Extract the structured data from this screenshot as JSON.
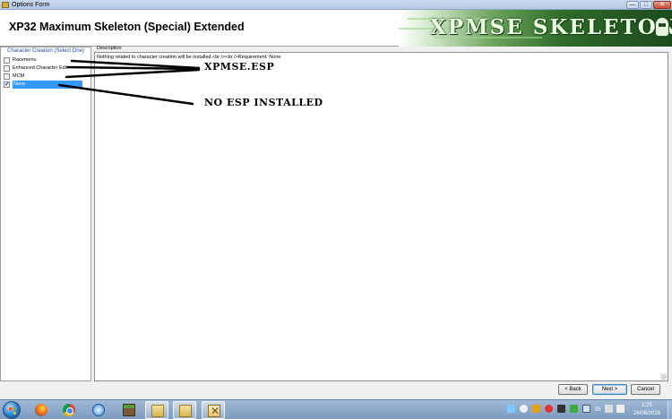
{
  "window": {
    "title": "Options Form",
    "buttons": {
      "minimize": "—",
      "maximize": "□",
      "close": "✕"
    }
  },
  "header": {
    "heading": "XP32 Maximum Skeleton (Special) Extended",
    "banner_text": "XPMSE SKELETON"
  },
  "left_panel": {
    "group_title": "Character Creation (Select One)",
    "options": [
      {
        "label": "Racemenu",
        "checked": false,
        "selected": false
      },
      {
        "label": "Enhanced Character Edit",
        "checked": false,
        "selected": false
      },
      {
        "label": "MCM",
        "checked": false,
        "selected": false
      },
      {
        "label": "None",
        "checked": true,
        "selected": true
      }
    ]
  },
  "description": {
    "label": "Description",
    "text": "Nothing related to character creation will be installed.<br /><br />Requirement: None"
  },
  "annotations": {
    "esp_note": "XPMSE.ESP",
    "none_note": "NO ESP INSTALLED"
  },
  "buttons": {
    "back": "< Back",
    "next": "Next >",
    "cancel": "Cancel"
  },
  "taskbar": {
    "apps": [
      "firefox-icon",
      "chrome-icon",
      "vuze-icon",
      "minecraft-icon",
      "folder-icon",
      "folder-icon",
      "options-form-icon"
    ],
    "tray_number": "35",
    "clock_time": "1:25",
    "clock_date": "26/06/2018"
  },
  "colors": {
    "selection": "#3399ff",
    "group_title": "#1f4aa8",
    "banner_green": "#2f6b2a"
  }
}
